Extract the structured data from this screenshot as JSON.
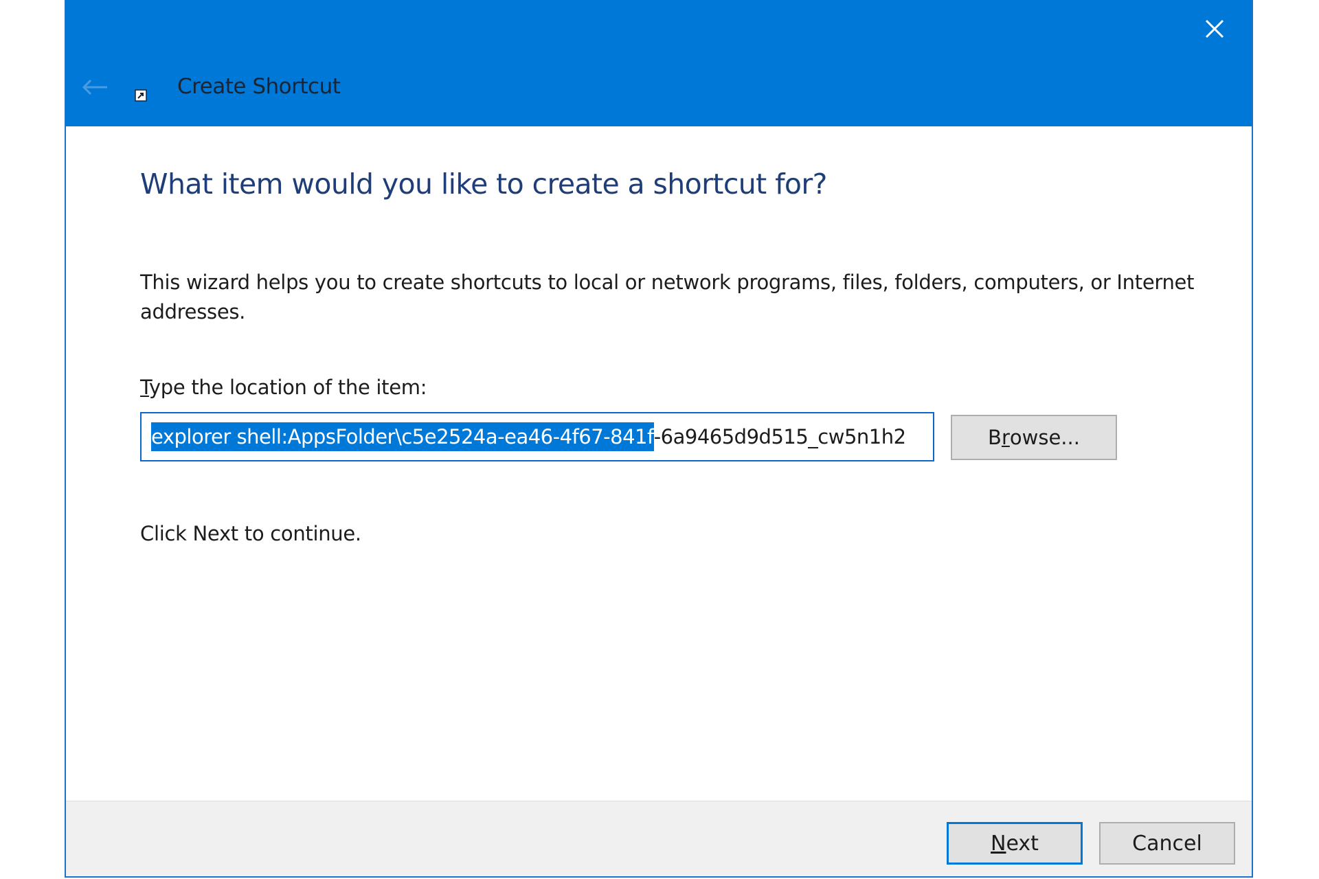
{
  "window": {
    "title": "Create Shortcut",
    "accent_color": "#0078d7",
    "icons": {
      "close": "close-icon",
      "back": "back-arrow-icon",
      "app": "shortcut-icon"
    }
  },
  "wizard": {
    "heading": "What item would you like to create a shortcut for?",
    "description": "This wizard helps you to create shortcuts to local or network programs, files, folders, computers, or Internet addresses.",
    "location_label_mnemonic": "T",
    "location_label_rest": "ype the location of the item:",
    "location_value_selected": "explorer shell:AppsFolder\\c5e2524a-ea46-4f67-841f",
    "location_value_unselected": "-6a9465d9d515_cw5n1h2",
    "browse_label_pre": "B",
    "browse_label_mnemonic": "r",
    "browse_label_post": "owse...",
    "continue_text": "Click Next to continue."
  },
  "footer": {
    "next_label_mnemonic": "N",
    "next_label_rest": "ext",
    "cancel_label": "Cancel"
  }
}
